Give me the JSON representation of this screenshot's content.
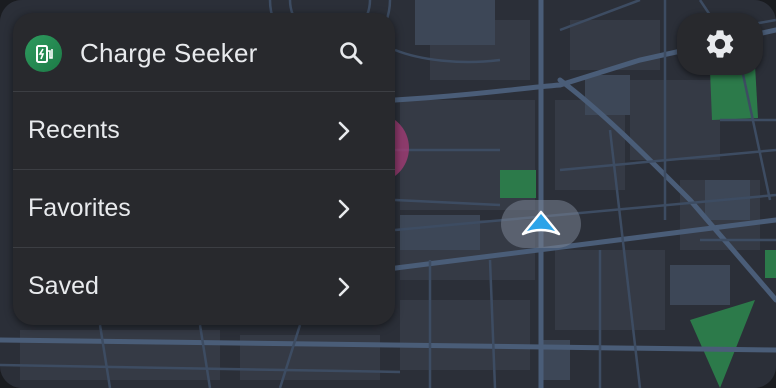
{
  "app": {
    "title": "Charge Seeker",
    "icon": "ev-charger-icon",
    "accent_color": "#2e9b5f"
  },
  "menu": {
    "items": [
      {
        "label": "Recents"
      },
      {
        "label": "Favorites"
      },
      {
        "label": "Saved"
      }
    ]
  },
  "controls": {
    "search_icon": "search-icon",
    "settings_icon": "gear-icon"
  },
  "map": {
    "theme": "dark",
    "road_color": "#3f4f66",
    "park_color": "#2c7a4a",
    "position_marker_color": "#2ba3e8"
  }
}
